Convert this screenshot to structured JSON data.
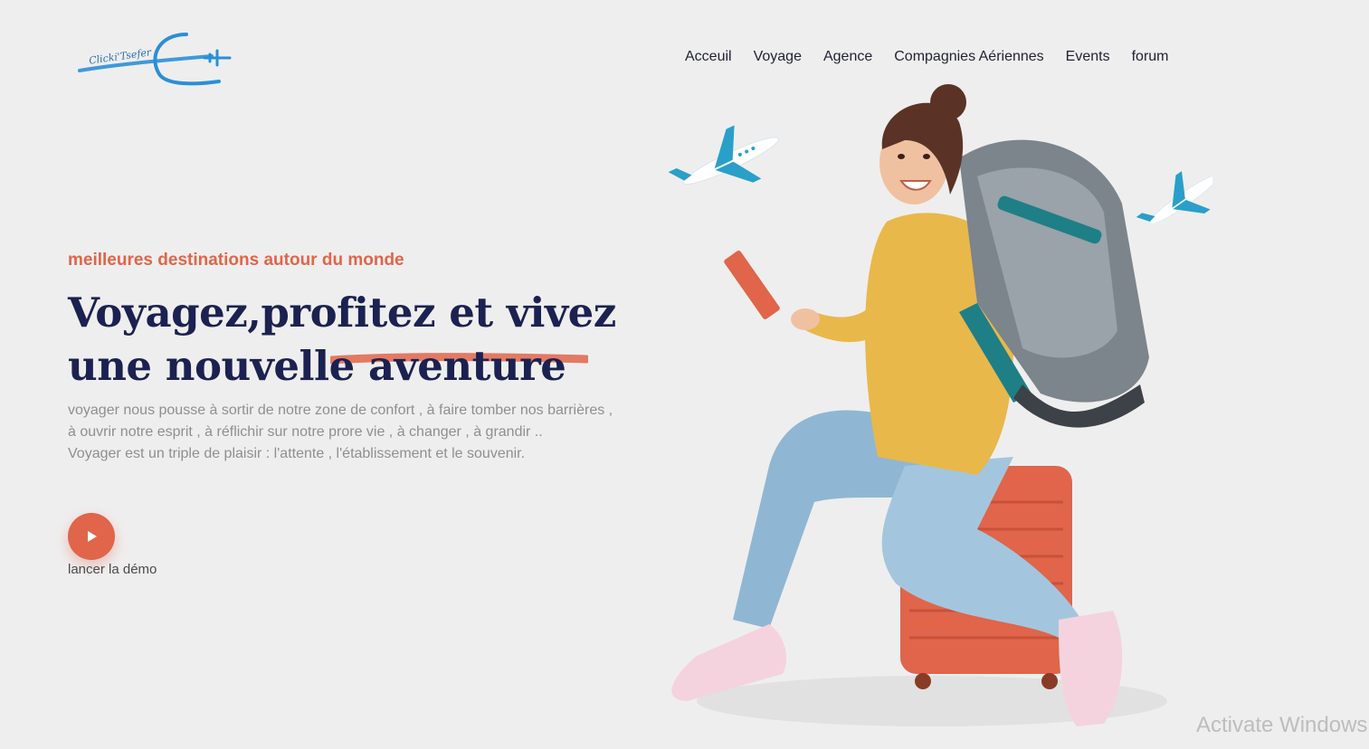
{
  "logo": {
    "text": "Clicki'Tsefer"
  },
  "nav": {
    "items": [
      "Acceuil",
      "Voyage",
      "Agence",
      "Compagnies Aériennes",
      "Events",
      "forum"
    ]
  },
  "hero": {
    "tagline": "meilleures destinations autour du monde",
    "headline_line1": "Voyagez,profitez et vivez",
    "headline_line2": "une nouvelle aventure",
    "desc_para1": "voyager nous pousse à sortir de notre zone de confort , à faire tomber nos barrières , à ouvrir notre esprit , à réflichir sur notre prore vie , à changer , à grandir ..",
    "desc_para2": "Voyager est un triple de plaisir : l'attente , l'établissement et le souvenir.",
    "play_label": "lancer la démo"
  },
  "watermark": "Activate Windows",
  "colors": {
    "accent": "#e0654a",
    "heading": "#1b2150",
    "background": "#efeeee",
    "logo_blue": "#2b8fd6"
  },
  "icons": {
    "play": "play-icon",
    "plane": "airplane-icon"
  }
}
